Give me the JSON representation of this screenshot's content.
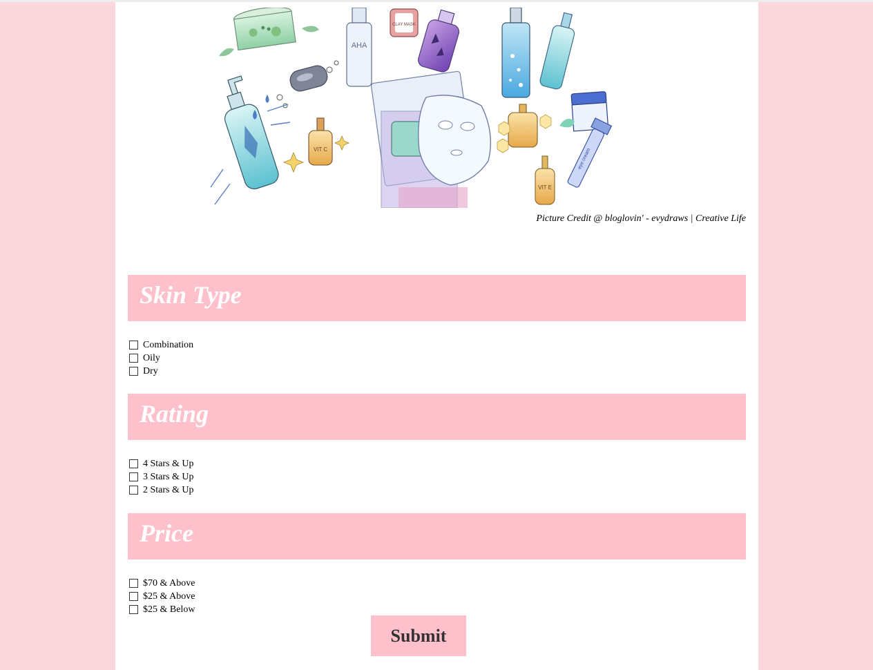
{
  "credit": {
    "prefix": "Picture Credit @ bloglovin' - evydraws",
    "separator": "|",
    "suffix": "Creative Life"
  },
  "hero": {
    "labels": {
      "aha": "AHA",
      "clay_mask": "CLAY MASK",
      "vit_c": "VIT C",
      "vit_e": "VIT E",
      "eye_cream": "eye cream"
    }
  },
  "sections": [
    {
      "title": "Skin Type",
      "options": [
        "Combination",
        "Oily",
        "Dry"
      ]
    },
    {
      "title": "Rating",
      "options": [
        "4 Stars & Up",
        "3 Stars & Up",
        "2 Stars & Up"
      ]
    },
    {
      "title": "Price",
      "options": [
        "$70 & Above",
        "$25 & Above",
        "$25 & Below"
      ]
    }
  ],
  "submit_label": "Submit",
  "colors": {
    "background": "#f9d7dc",
    "accent": "#fec0cb",
    "panel": "#ffffff"
  }
}
